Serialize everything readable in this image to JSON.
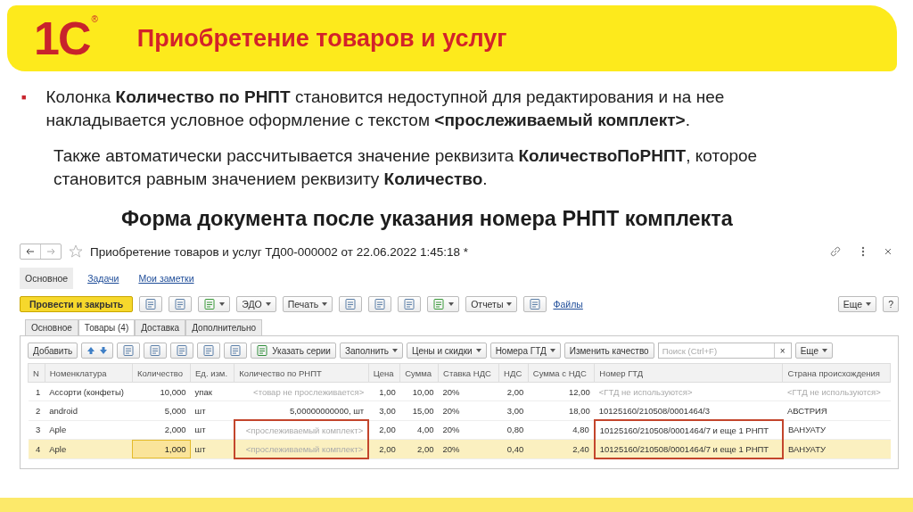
{
  "slide": {
    "logo": "1С",
    "logo_mark": "®",
    "title": "Приобретение товаров и услуг",
    "bullet": {
      "marker": "■",
      "text": "Колонка **Количество по РНПТ** становится недоступной для редактирования и на нее накладывается условное оформление с текстом **<прослеживаемый комплект>**."
    },
    "paragraph": "Также автоматически рассчитывается значение реквизита **КоличествоПоРНПТ**, которое становится равным значением реквизиту **Количество**.",
    "subtitle": "Форма документа после указания номера РНПТ комплекта"
  },
  "window": {
    "title": "Приобретение товаров и услуг ТД00-000002 от 22.06.2022 1:45:18 *",
    "nav": [
      {
        "label": "Основное",
        "selected": true
      },
      {
        "label": "Задачи",
        "selected": false
      },
      {
        "label": "Мои заметки",
        "selected": false
      }
    ],
    "toolbar": [
      {
        "kind": "primary",
        "label": "Провести и закрыть"
      },
      {
        "kind": "icon"
      },
      {
        "kind": "icon"
      },
      {
        "kind": "icon-menu"
      },
      {
        "kind": "menu",
        "label": "ЭДО"
      },
      {
        "kind": "menu",
        "label": "Печать"
      },
      {
        "kind": "icon"
      },
      {
        "kind": "icon"
      },
      {
        "kind": "icon"
      },
      {
        "kind": "icon-menu"
      },
      {
        "kind": "menu",
        "label": "Отчеты"
      },
      {
        "kind": "icon"
      },
      {
        "kind": "link",
        "label": "Файлы"
      },
      {
        "kind": "spacer"
      },
      {
        "kind": "menu",
        "label": "Еще"
      },
      {
        "kind": "button",
        "label": "?"
      }
    ],
    "tabs": [
      {
        "label": "Основное",
        "selected": false
      },
      {
        "label": "Товары (4)",
        "selected": true
      },
      {
        "label": "Доставка",
        "selected": false
      },
      {
        "label": "Дополнительно",
        "selected": false
      }
    ],
    "table_toolbar": [
      {
        "kind": "button",
        "label": "Добавить"
      },
      {
        "kind": "icon-pair"
      },
      {
        "kind": "icon"
      },
      {
        "kind": "icon"
      },
      {
        "kind": "icon"
      },
      {
        "kind": "icon"
      },
      {
        "kind": "icon"
      },
      {
        "kind": "icon-button",
        "label": "Указать серии"
      },
      {
        "kind": "menu",
        "label": "Заполнить"
      },
      {
        "kind": "menu",
        "label": "Цены и скидки"
      },
      {
        "kind": "menu",
        "label": "Номера ГТД"
      },
      {
        "kind": "button",
        "label": "Изменить качество"
      },
      {
        "kind": "search",
        "placeholder": "Поиск (Ctrl+F)",
        "clear": "×"
      },
      {
        "kind": "menu",
        "label": "Еще"
      }
    ],
    "table": {
      "columns": [
        {
          "label": "N",
          "kind": "number"
        },
        {
          "label": "Номенклатура",
          "kind": "text"
        },
        {
          "label": "Количество",
          "kind": "number"
        },
        {
          "label": "Ед. изм.",
          "kind": "text"
        },
        {
          "label": "Количество по РНПТ",
          "kind": "number"
        },
        {
          "label": "Цена",
          "kind": "number"
        },
        {
          "label": "Сумма",
          "kind": "number"
        },
        {
          "label": "Ставка НДС",
          "kind": "text"
        },
        {
          "label": "НДС",
          "kind": "number"
        },
        {
          "label": "Сумма с НДС",
          "kind": "number"
        },
        {
          "label": "Номер ГТД",
          "kind": "text"
        },
        {
          "label": "Страна происхождения",
          "kind": "text"
        }
      ],
      "rows": [
        {
          "selected": false,
          "cells": [
            {
              "text": "1"
            },
            {
              "text": "Ассорти (конфеты)"
            },
            {
              "text": "10,000"
            },
            {
              "text": "упак"
            },
            {
              "text": "<товар не прослеживается>",
              "muted": true
            },
            {
              "text": "1,00"
            },
            {
              "text": "10,00"
            },
            {
              "text": "20%"
            },
            {
              "text": "2,00"
            },
            {
              "text": "12,00"
            },
            {
              "text": "<ГТД не используются>",
              "muted": true
            },
            {
              "text": "<ГТД не используются>",
              "muted": true
            }
          ]
        },
        {
          "selected": false,
          "cells": [
            {
              "text": "2"
            },
            {
              "text": "android"
            },
            {
              "text": "5,000"
            },
            {
              "text": "шт"
            },
            {
              "text": "5,00000000000, шт"
            },
            {
              "text": "3,00"
            },
            {
              "text": "15,00"
            },
            {
              "text": "20%"
            },
            {
              "text": "3,00"
            },
            {
              "text": "18,00"
            },
            {
              "text": "10125160/210508/0001464/3"
            },
            {
              "text": "АВСТРИЯ"
            }
          ]
        },
        {
          "selected": false,
          "cells": [
            {
              "text": "3"
            },
            {
              "text": "Aple"
            },
            {
              "text": "2,000"
            },
            {
              "text": "шт"
            },
            {
              "text": "<прослеживаемый комплект>",
              "muted": true,
              "circled": true
            },
            {
              "text": "2,00"
            },
            {
              "text": "4,00"
            },
            {
              "text": "20%"
            },
            {
              "text": "0,80"
            },
            {
              "text": "4,80"
            },
            {
              "text": "10125160/210508/0001464/7 и еще 1 РНПТ",
              "circled": true
            },
            {
              "text": "ВАНУАТУ"
            }
          ]
        },
        {
          "selected": true,
          "cells": [
            {
              "text": "4"
            },
            {
              "text": "Aple"
            },
            {
              "text": "1,000",
              "current": true
            },
            {
              "text": "шт"
            },
            {
              "text": "<прослеживаемый комплект>",
              "muted": true,
              "circled": true
            },
            {
              "text": "2,00"
            },
            {
              "text": "2,00"
            },
            {
              "text": "20%"
            },
            {
              "text": "0,40"
            },
            {
              "text": "2,40"
            },
            {
              "text": "10125160/210508/0001464/7 и еще 1 РНПТ",
              "circled": true
            },
            {
              "text": "ВАНУАТУ"
            }
          ]
        }
      ]
    }
  }
}
